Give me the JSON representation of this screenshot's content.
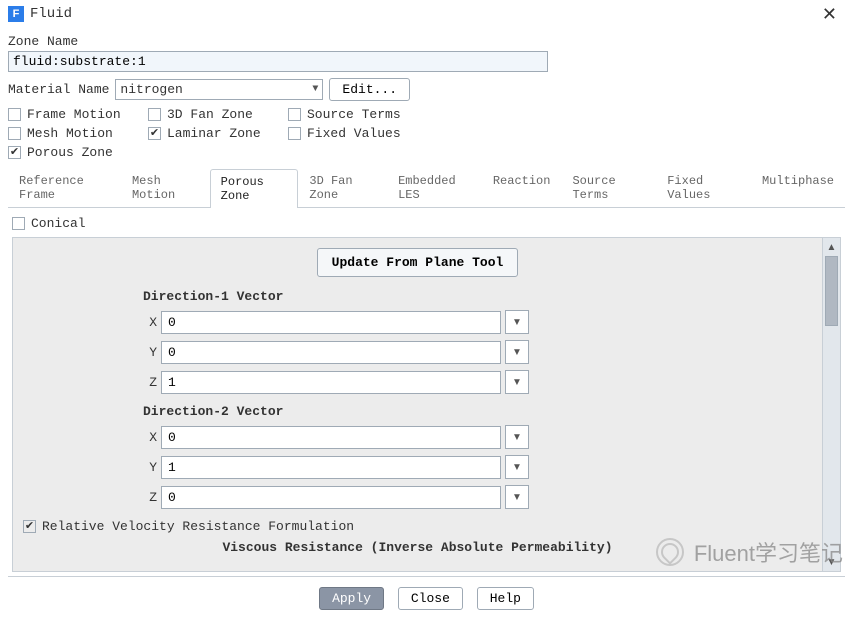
{
  "window": {
    "title": "Fluid",
    "icon_letter": "F"
  },
  "zone": {
    "label": "Zone Name",
    "value": "fluid:substrate:1"
  },
  "material": {
    "label": "Material Name",
    "selected": "nitrogen",
    "edit_btn": "Edit..."
  },
  "options": {
    "frame_motion": {
      "label": "Frame Motion",
      "checked": false
    },
    "fan_zone": {
      "label": "3D Fan Zone",
      "checked": false
    },
    "source_terms": {
      "label": "Source Terms",
      "checked": false
    },
    "mesh_motion": {
      "label": "Mesh Motion",
      "checked": false
    },
    "laminar_zone": {
      "label": "Laminar Zone",
      "checked": true
    },
    "fixed_values": {
      "label": "Fixed Values",
      "checked": false
    },
    "porous_zone": {
      "label": "Porous Zone",
      "checked": true
    }
  },
  "tabs": [
    {
      "label": "Reference Frame"
    },
    {
      "label": "Mesh Motion"
    },
    {
      "label": "Porous Zone",
      "active": true
    },
    {
      "label": "3D Fan Zone"
    },
    {
      "label": "Embedded LES"
    },
    {
      "label": "Reaction"
    },
    {
      "label": "Source Terms"
    },
    {
      "label": "Fixed Values"
    },
    {
      "label": "Multiphase"
    }
  ],
  "porous": {
    "conical": {
      "label": "Conical",
      "checked": false
    },
    "update_btn": "Update From Plane Tool",
    "dir1_title": "Direction-1 Vector",
    "dir2_title": "Direction-2 Vector",
    "axes": {
      "x": "X",
      "y": "Y",
      "z": "Z"
    },
    "dir1": {
      "x": "0",
      "y": "0",
      "z": "1"
    },
    "dir2": {
      "x": "0",
      "y": "1",
      "z": "0"
    },
    "rel_velocity": {
      "label": "Relative Velocity Resistance Formulation",
      "checked": true
    },
    "viscous_title": "Viscous Resistance (Inverse Absolute Permeability)"
  },
  "actions": {
    "apply": "Apply",
    "close": "Close",
    "help": "Help"
  },
  "watermark": "Fluent学习笔记"
}
